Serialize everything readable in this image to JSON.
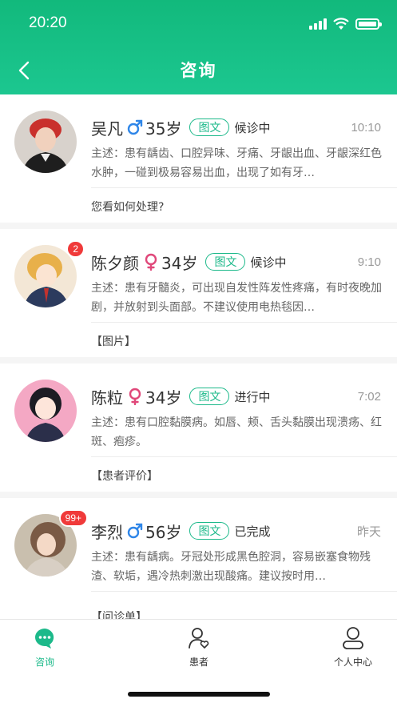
{
  "status_bar": {
    "time": "20:20"
  },
  "nav": {
    "title": "咨询"
  },
  "consultations": [
    {
      "name": "吴凡",
      "gender": "male",
      "age": "35岁",
      "tag": "图文",
      "status": "候诊中",
      "time": "10:10",
      "badge": "",
      "description": "主述：患有龋齿、口腔异味、牙痛、牙龈出血、牙龈深红色水肿，一碰到极易容易出血，出现了如有牙…",
      "reply": "您看如何处理?"
    },
    {
      "name": "陈夕颜",
      "gender": "female",
      "age": "34岁",
      "tag": "图文",
      "status": "候诊中",
      "time": "9:10",
      "badge": "2",
      "description": "主述：患有牙髓炎，可出现自发性阵发性疼痛，有时夜晚加剧，并放射到头面部。不建议使用电热毯因…",
      "reply": "【图片】"
    },
    {
      "name": "陈粒",
      "gender": "female",
      "age": "34岁",
      "tag": "图文",
      "status": "进行中",
      "time": "7:02",
      "badge": "",
      "description": "主述：患有口腔黏膜病。如唇、颊、舌头黏膜出现溃疡、红斑、疱疹。",
      "reply": "【患者评价】"
    },
    {
      "name": "李烈",
      "gender": "male",
      "age": "56岁",
      "tag": "图文",
      "status": "已完成",
      "time": "昨天",
      "badge": "99+",
      "description": "主述：患有龋病。牙冠处形成黑色腔洞，容易嵌塞食物残渣、软垢，遇冷热刺激出现酸痛。建议按时用…",
      "reply": "【问诊单】"
    }
  ],
  "tabbar": {
    "items": [
      {
        "label": "咨询",
        "icon": "chat-bubble-icon",
        "active": true
      },
      {
        "label": "患者",
        "icon": "patient-icon",
        "active": false
      },
      {
        "label": "个人中心",
        "icon": "profile-icon",
        "active": false
      }
    ]
  },
  "colors": {
    "primary": "#1cb98a",
    "header_top": "#12b97c",
    "badge": "#f03a3a"
  }
}
